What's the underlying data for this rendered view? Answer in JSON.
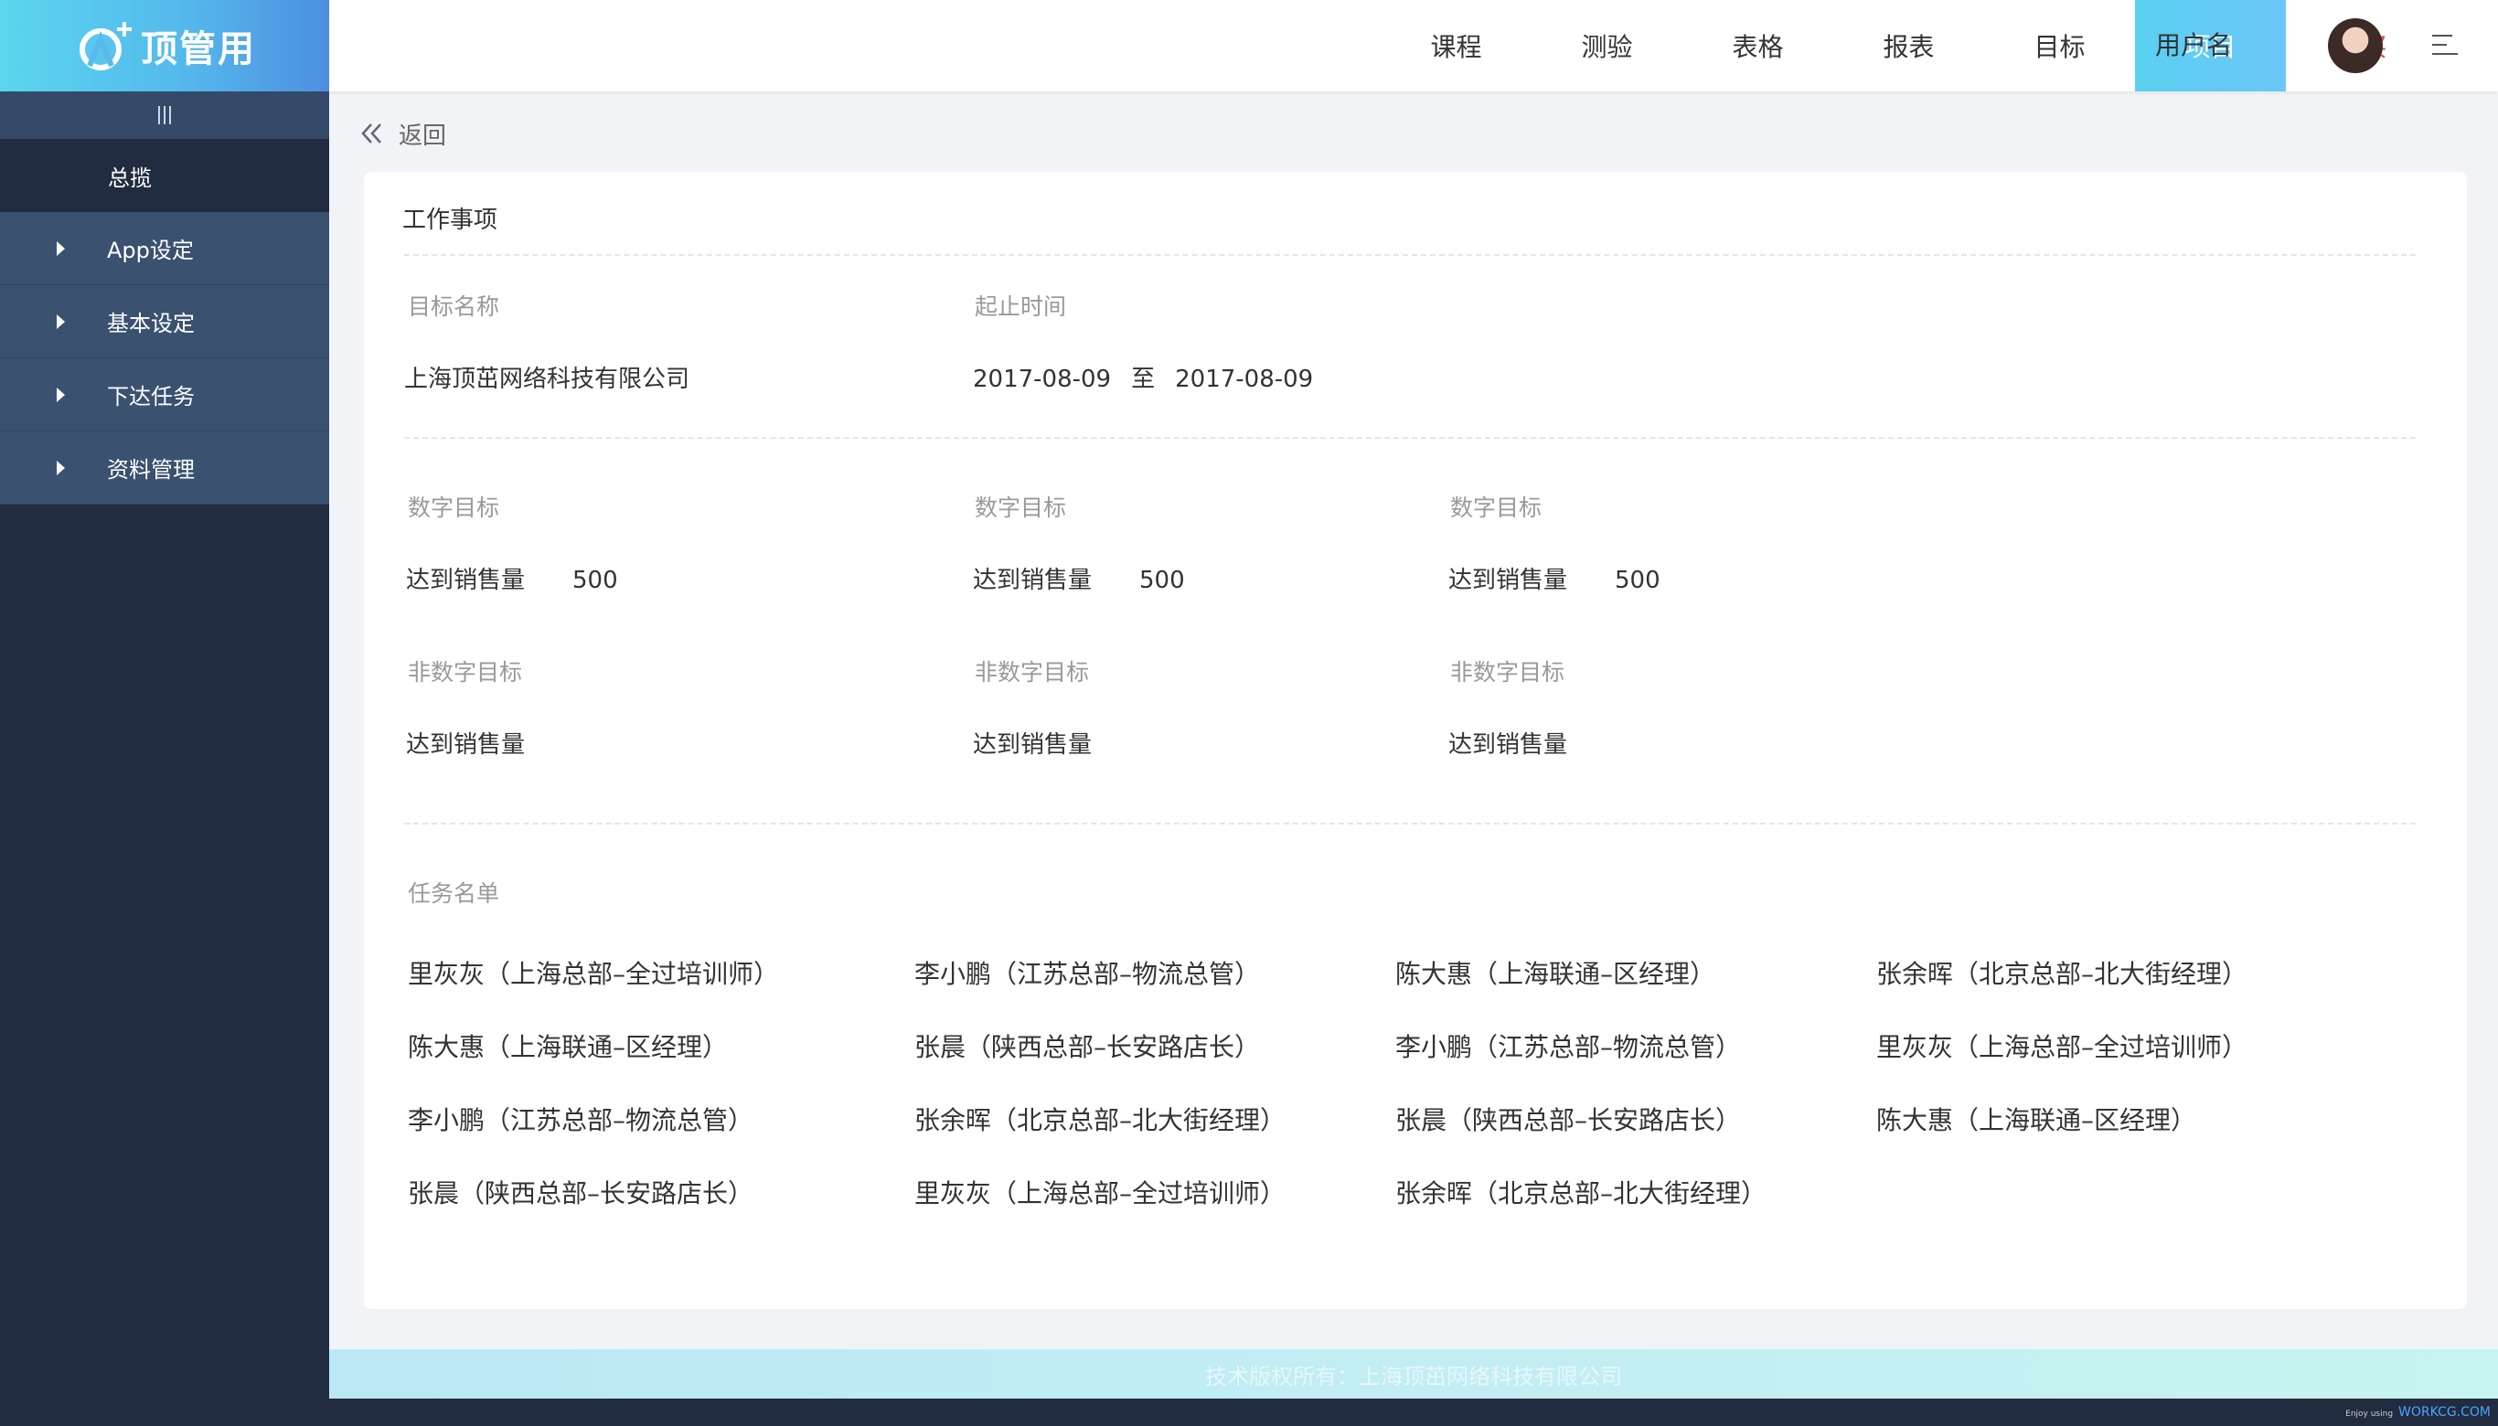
{
  "brand": {
    "logo_text": "顶管用",
    "colors": {
      "accent": "#5ad6ef",
      "sidebar": "#222c40",
      "active_tab": "#5ad0f1",
      "buy": "#e8464b"
    }
  },
  "sidebar": {
    "toggle_icon": "menu-bars-icon",
    "overview": "总揽",
    "items": [
      {
        "label": "App设定"
      },
      {
        "label": "基本设定"
      },
      {
        "label": "下达任务"
      },
      {
        "label": "资料管理"
      }
    ]
  },
  "topnav": {
    "tabs": [
      {
        "label": "课程"
      },
      {
        "label": "测验"
      },
      {
        "label": "表格"
      },
      {
        "label": "报表"
      },
      {
        "label": "目标"
      },
      {
        "label": "项目",
        "active": true
      },
      {
        "label": "购买"
      }
    ],
    "username": "用户名",
    "menu_icon": "hamburger-menu-icon"
  },
  "back": {
    "label": "返回"
  },
  "card": {
    "title": "工作事项",
    "target_name_label": "目标名称",
    "period_label": "起止时间",
    "target_name": "上海顶茁网络科技有限公司",
    "start_date": "2017-08-09",
    "to": "至",
    "end_date": "2017-08-09",
    "numeric_targets": [
      {
        "label": "数字目标",
        "name": "达到销售量",
        "value": "500"
      },
      {
        "label": "数字目标",
        "name": "达到销售量",
        "value": "500"
      },
      {
        "label": "数字目标",
        "name": "达到销售量",
        "value": "500"
      }
    ],
    "non_numeric_targets": [
      {
        "label": "非数字目标",
        "name": "达到销售量"
      },
      {
        "label": "非数字目标",
        "name": "达到销售量"
      },
      {
        "label": "非数字目标",
        "name": "达到销售量"
      }
    ],
    "task_list_label": "任务名单",
    "tasks": [
      [
        "里灰灰（上海总部–全过培训师）",
        "李小鹏（江苏总部–物流总管）",
        "陈大惠（上海联通–区经理）",
        "张余晖（北京总部–北大街经理）"
      ],
      [
        "陈大惠（上海联通–区经理）",
        "张晨（陕西总部–长安路店长）",
        "李小鹏（江苏总部–物流总管）",
        "里灰灰（上海总部–全过培训师）"
      ],
      [
        "李小鹏（江苏总部–物流总管）",
        "张余晖（北京总部–北大街经理）",
        "张晨（陕西总部–长安路店长）",
        "陈大惠（上海联通–区经理）"
      ],
      [
        "张晨（陕西总部–长安路店长）",
        "里灰灰（上海总部–全过培训师）",
        "张余晖（北京总部–北大街经理）",
        ""
      ]
    ]
  },
  "footer": {
    "text": "技术版权所有：上海顶茁网络科技有限公司"
  },
  "watermark": {
    "prefix": "Enjoy using",
    "brand": "WORKCG.COM"
  }
}
